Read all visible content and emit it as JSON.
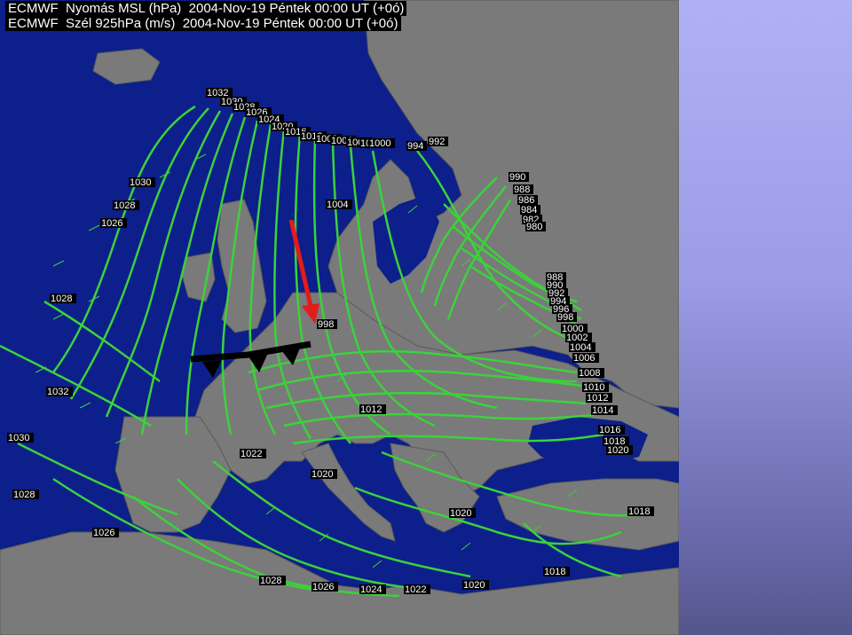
{
  "map": {
    "header": {
      "line1": "ECMWF  Nyomás MSL (hPa)  2004-Nov-19 Péntek 00:00 UT (+0ó)",
      "line2": "ECMWF  Szél 925hPa (m/s)  2004-Nov-19 Péntek 00:00 UT (+0ó)"
    },
    "colors": {
      "sea": "#0c1f8a",
      "land": "#777777",
      "isobar": "#3bd23b",
      "front": "#000000",
      "arrow": "#e41b1b",
      "side_panel_top": "#b0b0f6",
      "side_panel_bottom": "#55558d"
    },
    "isobar_labels": [
      "1032",
      "1030",
      "1028",
      "1026",
      "1024",
      "1020",
      "1016",
      "1012",
      "1008",
      "1006",
      "1004",
      "1002",
      "1000",
      "1030",
      "1028",
      "1026",
      "1004",
      "994",
      "992",
      "990",
      "988",
      "986",
      "984",
      "982",
      "980",
      "998",
      "1028",
      "1032",
      "1030",
      "1028",
      "1026",
      "1022",
      "1020",
      "1012",
      "1020",
      "988",
      "990",
      "992",
      "994",
      "996",
      "998",
      "1000",
      "1002",
      "1004",
      "1006",
      "1008",
      "1010",
      "1012",
      "1014",
      "1016",
      "1018",
      "1020",
      "1018",
      "1028",
      "1026",
      "1024",
      "1022",
      "1020",
      "1018"
    ]
  }
}
